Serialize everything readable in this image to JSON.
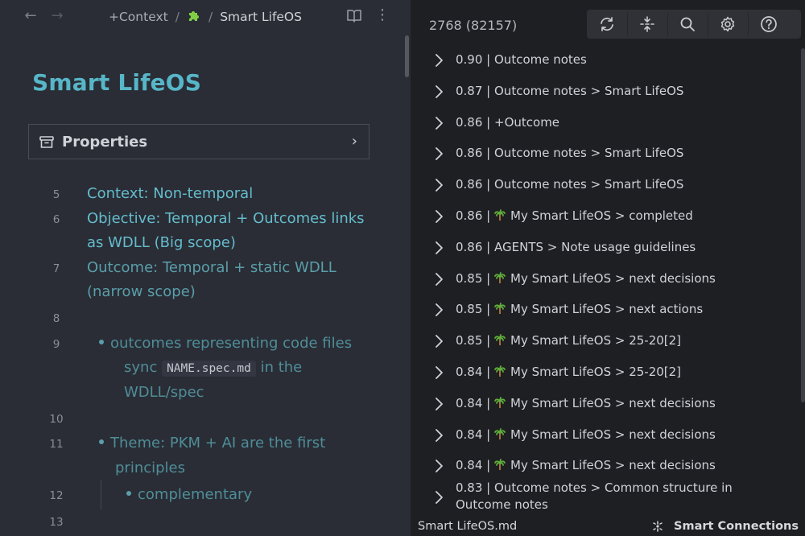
{
  "editor": {
    "breadcrumb": {
      "folder": "+Context",
      "separator": "/",
      "icon": "puzzle-piece-icon",
      "current": "Smart LifeOS"
    },
    "title": "Smart LifeOS",
    "properties_label": "Properties",
    "lines": [
      {
        "num": "5",
        "text": "Context: Non-temporal"
      },
      {
        "num": "6",
        "text_a": "Objective: Temporal + Outcomes links",
        "text_b": "as WDLL (Big scope)"
      },
      {
        "num": "7",
        "text_a": "Outcome: Temporal + static WDLL",
        "text_b": "(narrow scope)"
      },
      {
        "num": "8"
      },
      {
        "num": "9",
        "text_a": "outcomes representing code files",
        "pre": "sync",
        "code": "NAME.spec.md",
        "post": "in the",
        "text_c": "WDLL/spec"
      },
      {
        "num": "10"
      },
      {
        "num": "11",
        "text_a": "Theme: PKM + AI are the first",
        "text_b": "principles"
      },
      {
        "num": "12",
        "text": "complementary"
      },
      {
        "num": "13"
      }
    ]
  },
  "connections": {
    "count": "2768 (82157)",
    "toolbar": [
      "refresh-icon",
      "expand-collapse-icon",
      "search-icon",
      "settings-icon",
      "help-icon"
    ],
    "results": [
      {
        "score": "0.90",
        "label": "Outcome notes",
        "palm": false
      },
      {
        "score": "0.87",
        "label": "Outcome notes > Smart LifeOS",
        "palm": false
      },
      {
        "score": "0.86",
        "label": "+Outcome",
        "palm": false
      },
      {
        "score": "0.86",
        "label": "Outcome notes > Smart LifeOS",
        "palm": false
      },
      {
        "score": "0.86",
        "label": "Outcome notes > Smart LifeOS",
        "palm": false
      },
      {
        "score": "0.86",
        "label": "My Smart LifeOS > completed",
        "palm": true
      },
      {
        "score": "0.86",
        "label": "AGENTS > Note usage guidelines",
        "palm": false
      },
      {
        "score": "0.85",
        "label": "My Smart LifeOS > next decisions",
        "palm": true
      },
      {
        "score": "0.85",
        "label": "My Smart LifeOS > next actions",
        "palm": true
      },
      {
        "score": "0.85",
        "label": "My Smart LifeOS > 25-20[2]",
        "palm": true
      },
      {
        "score": "0.84",
        "label": "My Smart LifeOS > 25-20[2]",
        "palm": true
      },
      {
        "score": "0.84",
        "label": "My Smart LifeOS > next decisions",
        "palm": true
      },
      {
        "score": "0.84",
        "label": "My Smart LifeOS > next decisions",
        "palm": true
      },
      {
        "score": "0.84",
        "label": "My Smart LifeOS > next decisions",
        "palm": true
      },
      {
        "score": "0.83",
        "label": "Outcome notes > Common structure in Outcome notes",
        "palm": false
      }
    ]
  },
  "status": {
    "file": "Smart LifeOS.md",
    "plugin": "Smart Connections"
  },
  "colors": {
    "accent": "#57b6c8",
    "editor_bg": "#2a2d35",
    "panel_bg": "#1e1f23",
    "palm_green": "#5fae3a"
  }
}
